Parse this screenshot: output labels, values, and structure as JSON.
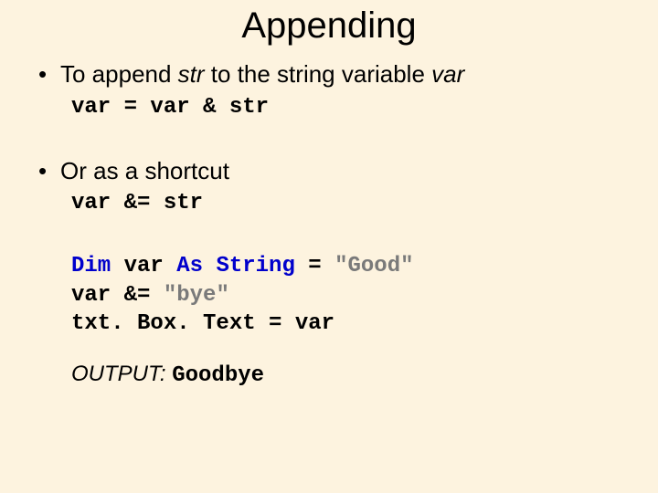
{
  "title": "Appending",
  "bullet1": {
    "pre": "To append ",
    "em1": "str",
    "mid": " to the string variable ",
    "em2": "var"
  },
  "code1": "var = var & str",
  "bullet2": "Or as a shortcut",
  "code2": "var &= str",
  "code3": {
    "l1_a": "Dim",
    "l1_b": " var ",
    "l1_c": "As String",
    "l1_d": " = ",
    "l1_e": "\"Good\"",
    "l2_a": "var &= ",
    "l2_b": "\"bye\"",
    "l3": "txt. Box. Text = var"
  },
  "output": {
    "label": "OUTPUT:",
    "value": "Goodbye"
  }
}
